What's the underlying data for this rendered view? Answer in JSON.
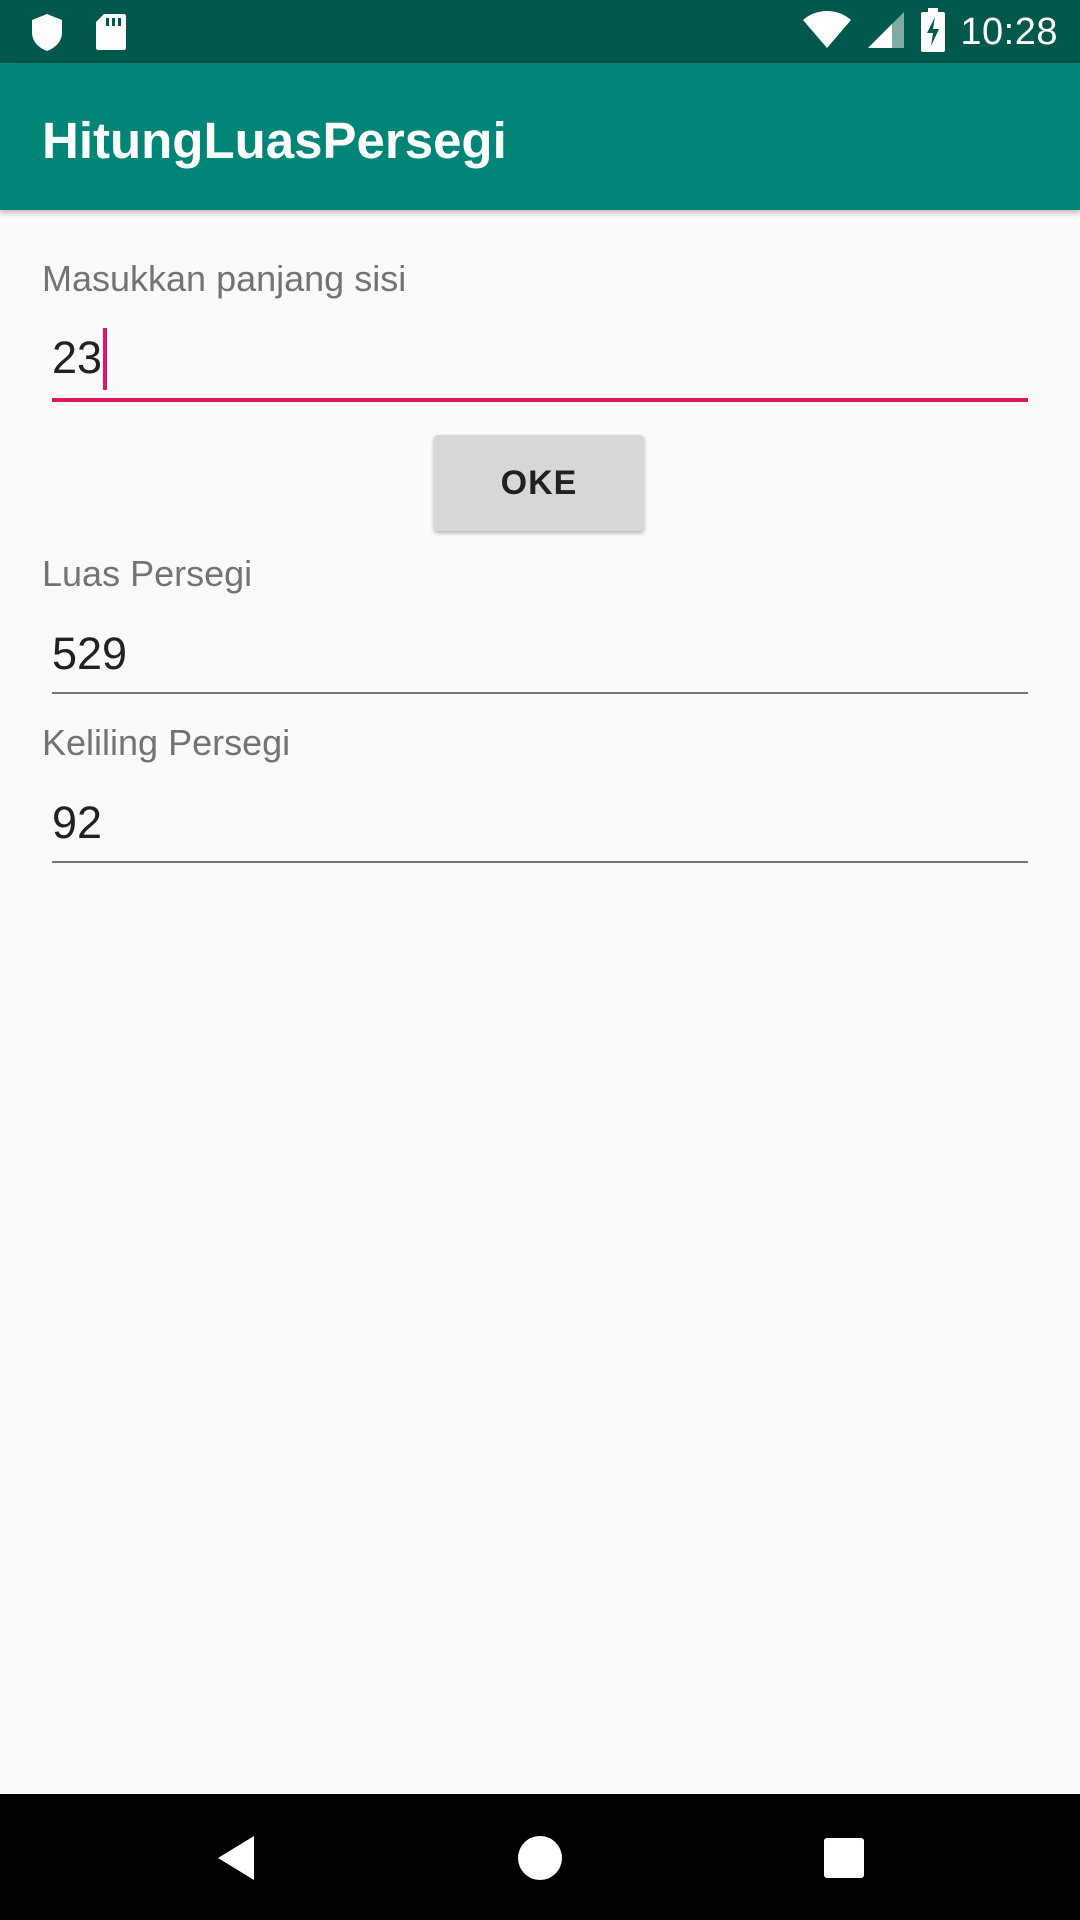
{
  "status_bar": {
    "time": "10:28",
    "icons": [
      "shield-icon",
      "sd-card-icon",
      "wifi-icon",
      "signal-icon",
      "battery-charging-icon"
    ]
  },
  "app_bar": {
    "title": "HitungLuasPersegi"
  },
  "form": {
    "side_label": "Masukkan panjang sisi",
    "side_value": "23",
    "button_label": "OKE",
    "area_label": "Luas Persegi",
    "area_value": "529",
    "perimeter_label": "Keliling Persegi",
    "perimeter_value": "92"
  },
  "nav_bar": {
    "icons": [
      "back-icon",
      "home-icon",
      "recents-icon"
    ]
  },
  "colors": {
    "status_bar": "#00574b",
    "app_bar": "#008577",
    "accent": "#d81b60",
    "background": "#fafafa"
  }
}
